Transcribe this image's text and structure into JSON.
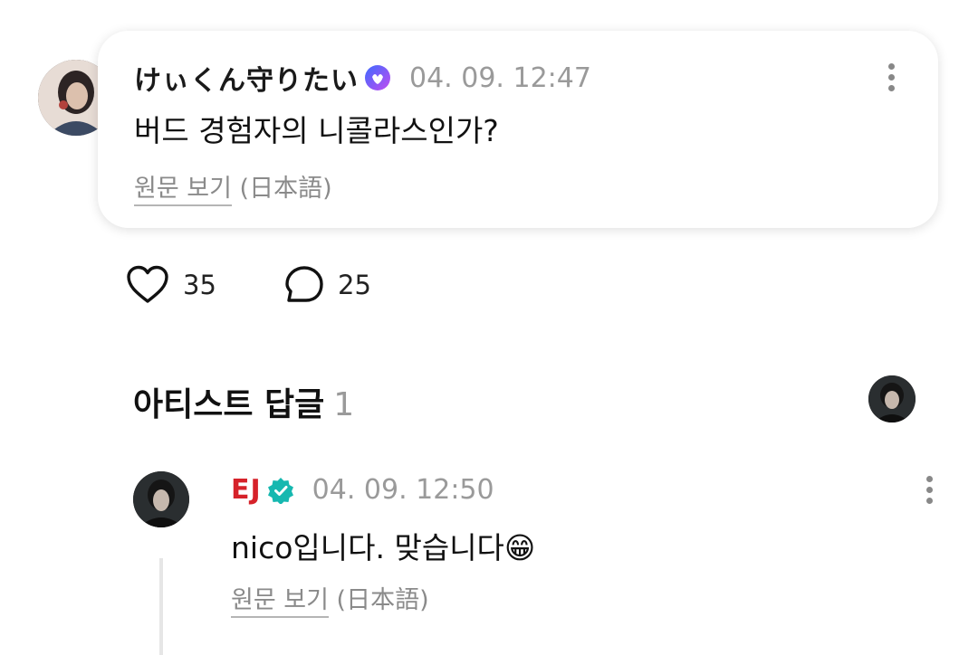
{
  "post": {
    "author": "けぃくん守りたい",
    "timestamp": "04. 09. 12:47",
    "text": "버드 경험자의 니콜라스인가?",
    "translate_label": "원문 보기",
    "translate_lang": "(日本語)",
    "likes": "35",
    "comments": "25"
  },
  "artist_replies": {
    "title": "아티스트 답글",
    "count": "1",
    "replies": [
      {
        "author": "EJ",
        "timestamp": "04. 09. 12:50",
        "text": "nico입니다. 맞습니다😁",
        "translate_label": "원문 보기",
        "translate_lang": "(日本語)"
      }
    ]
  },
  "colors": {
    "artist_name": "#d6222a",
    "artist_badge": "#16b8b0",
    "user_badge_a": "#3d6bff",
    "user_badge_b": "#c24cf0",
    "muted": "#9a9a9a"
  }
}
